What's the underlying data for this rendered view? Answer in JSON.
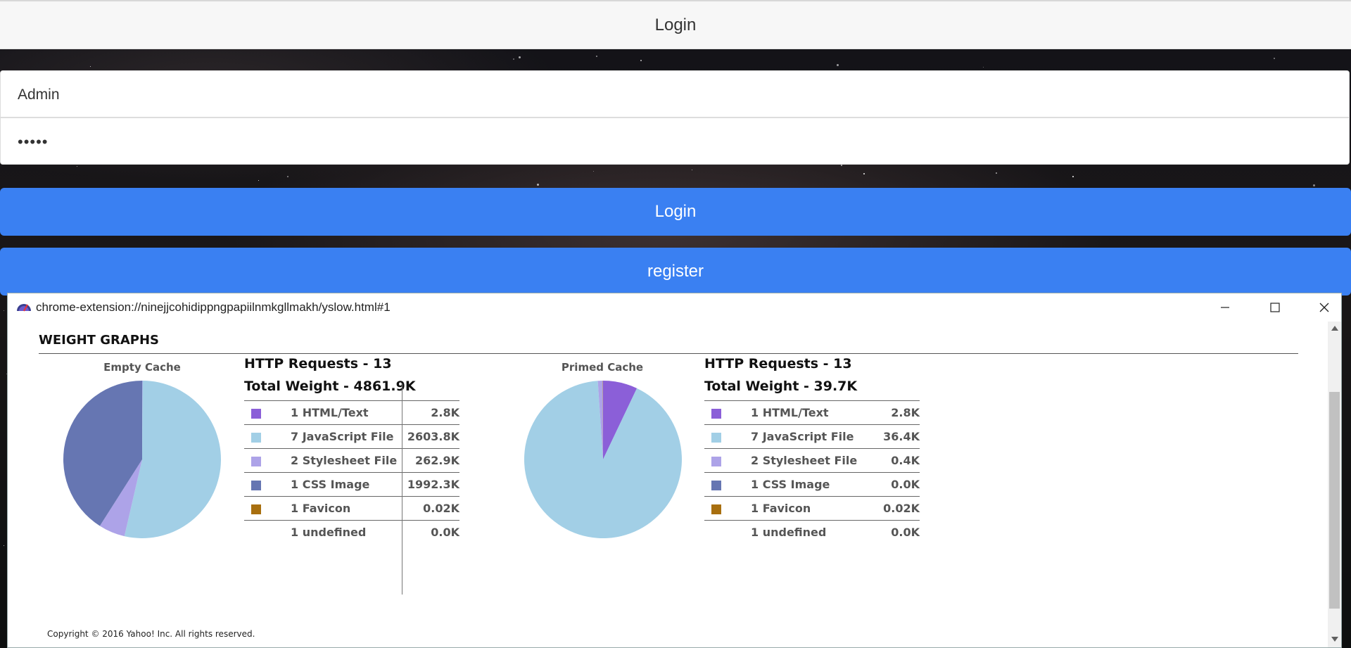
{
  "page": {
    "header_title": "Login",
    "username_value": "Admin",
    "password_value": "•••••",
    "login_button": "Login",
    "register_button": "register"
  },
  "popup": {
    "url": "chrome-extension://ninejjcohidippngpapiilnmkgllmakh/yslow.html#1",
    "section_title": "WEIGHT GRAPHS",
    "copyright": "Copyright © 2016 Yahoo! Inc. All rights reserved.",
    "colors": {
      "html": "#8b5fd8",
      "javascript": "#a2cfe6",
      "stylesheet": "#ada3e8",
      "cssimage": "#6676b2",
      "favicon": "#a86f0f"
    },
    "empty": {
      "chart_label": "Empty Cache",
      "requests": "HTTP Requests - 13",
      "weight": "Total Weight - 4861.9K",
      "rows": [
        {
          "swatch": "html",
          "label": "1 HTML/Text",
          "value": "2.8K"
        },
        {
          "swatch": "javascript",
          "label": "7 JavaScript File",
          "value": "2603.8K"
        },
        {
          "swatch": "stylesheet",
          "label": "2 Stylesheet File",
          "value": "262.9K"
        },
        {
          "swatch": "cssimage",
          "label": "1 CSS Image",
          "value": "1992.3K"
        },
        {
          "swatch": "favicon",
          "label": "1 Favicon",
          "value": "0.02K"
        },
        {
          "swatch": "",
          "label": "1 undefined",
          "value": "0.0K"
        }
      ]
    },
    "primed": {
      "chart_label": "Primed Cache",
      "requests": "HTTP Requests - 13",
      "weight": "Total Weight - 39.7K",
      "rows": [
        {
          "swatch": "html",
          "label": "1 HTML/Text",
          "value": "2.8K"
        },
        {
          "swatch": "javascript",
          "label": "7 JavaScript File",
          "value": "36.4K"
        },
        {
          "swatch": "stylesheet",
          "label": "2 Stylesheet File",
          "value": "0.4K"
        },
        {
          "swatch": "cssimage",
          "label": "1 CSS Image",
          "value": "0.0K"
        },
        {
          "swatch": "favicon",
          "label": "1 Favicon",
          "value": "0.02K"
        },
        {
          "swatch": "",
          "label": "1 undefined",
          "value": "0.0K"
        }
      ]
    }
  },
  "chart_data": [
    {
      "type": "pie",
      "title": "Empty Cache",
      "categories": [
        "HTML/Text",
        "JavaScript File",
        "Stylesheet File",
        "CSS Image",
        "Favicon",
        "undefined"
      ],
      "values": [
        2.8,
        2603.8,
        262.9,
        1992.3,
        0.02,
        0.0
      ]
    },
    {
      "type": "pie",
      "title": "Primed Cache",
      "categories": [
        "HTML/Text",
        "JavaScript File",
        "Stylesheet File",
        "CSS Image",
        "Favicon",
        "undefined"
      ],
      "values": [
        2.8,
        36.4,
        0.4,
        0.0,
        0.02,
        0.0
      ]
    }
  ]
}
